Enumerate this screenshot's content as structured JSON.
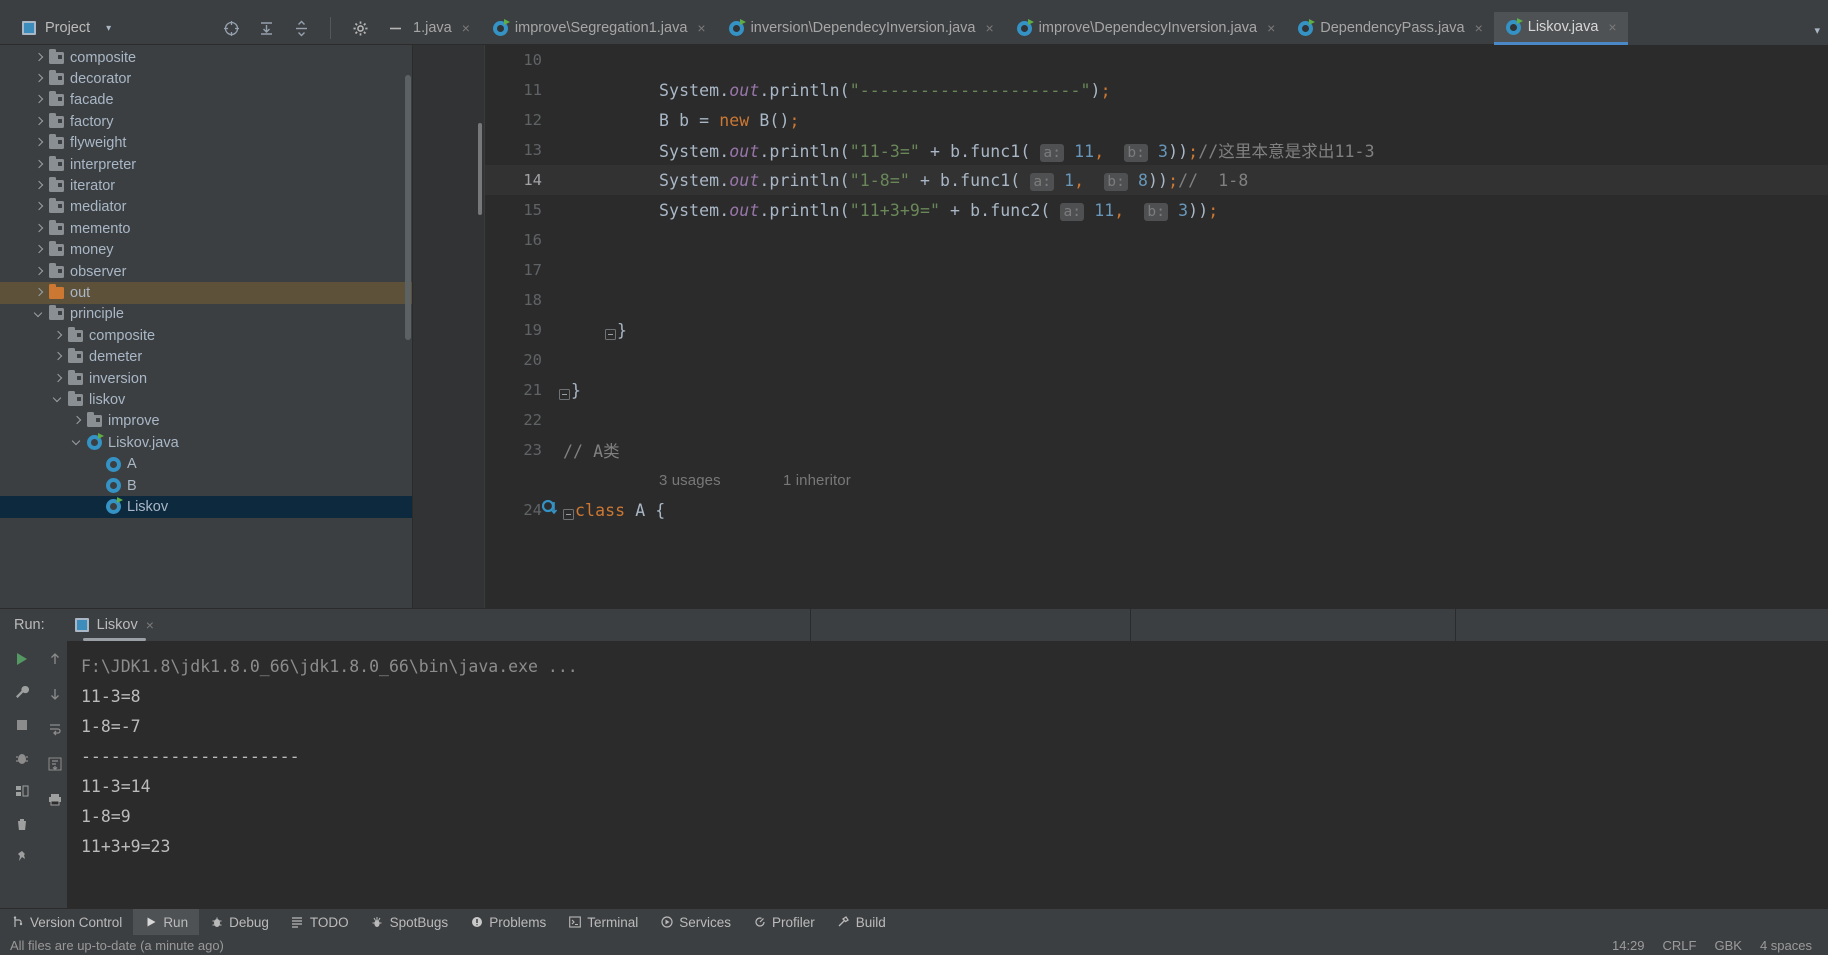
{
  "window": {
    "project_tool": {
      "title": "Project",
      "icons": [
        "target-icon",
        "expand-all-icon",
        "collapse-all-icon",
        "settings-gear-icon",
        "hide-icon"
      ]
    }
  },
  "tabs": {
    "items": [
      {
        "label": "1.java",
        "clipped": true,
        "active": false,
        "close": "×"
      },
      {
        "label": "improve\\Segregation1.java",
        "clipped": false,
        "active": false,
        "close": "×"
      },
      {
        "label": "inversion\\DependecyInversion.java",
        "clipped": false,
        "active": false,
        "close": "×"
      },
      {
        "label": "improve\\DependecyInversion.java",
        "clipped": false,
        "active": false,
        "close": "×"
      },
      {
        "label": "DependencyPass.java",
        "clipped": false,
        "active": false,
        "close": "×"
      },
      {
        "label": "Liskov.java",
        "clipped": false,
        "active": true,
        "close": "×"
      }
    ],
    "overflow_chevron": "▾"
  },
  "sidebar": {
    "items": [
      {
        "label": "composite",
        "indent": 0,
        "type": "folder",
        "state": "closed",
        "sel": ""
      },
      {
        "label": "decorator",
        "indent": 0,
        "type": "folder",
        "state": "closed",
        "sel": ""
      },
      {
        "label": "facade",
        "indent": 0,
        "type": "folder",
        "state": "closed",
        "sel": ""
      },
      {
        "label": "factory",
        "indent": 0,
        "type": "folder",
        "state": "closed",
        "sel": ""
      },
      {
        "label": "flyweight",
        "indent": 0,
        "type": "folder",
        "state": "closed",
        "sel": ""
      },
      {
        "label": "interpreter",
        "indent": 0,
        "type": "folder",
        "state": "closed",
        "sel": ""
      },
      {
        "label": "iterator",
        "indent": 0,
        "type": "folder",
        "state": "closed",
        "sel": ""
      },
      {
        "label": "mediator",
        "indent": 0,
        "type": "folder",
        "state": "closed",
        "sel": ""
      },
      {
        "label": "memento",
        "indent": 0,
        "type": "folder",
        "state": "closed",
        "sel": ""
      },
      {
        "label": "money",
        "indent": 0,
        "type": "folder",
        "state": "closed",
        "sel": ""
      },
      {
        "label": "observer",
        "indent": 0,
        "type": "folder",
        "state": "closed",
        "sel": ""
      },
      {
        "label": "out",
        "indent": 0,
        "type": "folder-orange",
        "state": "closed",
        "sel": "out"
      },
      {
        "label": "principle",
        "indent": 0,
        "type": "folder",
        "state": "open",
        "sel": ""
      },
      {
        "label": "composite",
        "indent": 1,
        "type": "folder",
        "state": "closed",
        "sel": ""
      },
      {
        "label": "demeter",
        "indent": 1,
        "type": "folder",
        "state": "closed",
        "sel": ""
      },
      {
        "label": "inversion",
        "indent": 1,
        "type": "folder",
        "state": "closed",
        "sel": ""
      },
      {
        "label": "liskov",
        "indent": 1,
        "type": "folder",
        "state": "open",
        "sel": ""
      },
      {
        "label": "improve",
        "indent": 2,
        "type": "folder",
        "state": "closed",
        "sel": ""
      },
      {
        "label": "Liskov.java",
        "indent": 2,
        "type": "java-run",
        "state": "open",
        "sel": ""
      },
      {
        "label": "A",
        "indent": 3,
        "type": "class",
        "state": "none",
        "sel": ""
      },
      {
        "label": "B",
        "indent": 3,
        "type": "class",
        "state": "none",
        "sel": ""
      },
      {
        "label": "Liskov",
        "indent": 3,
        "type": "class-run",
        "state": "none",
        "sel": "blue"
      }
    ]
  },
  "editor": {
    "lines": [
      {
        "num": "10",
        "current": false,
        "tokens": []
      },
      {
        "num": "11",
        "current": false,
        "tokens": [
          {
            "t": "System",
            "c": "punc"
          },
          {
            "t": ".",
            "c": "punc"
          },
          {
            "t": "out",
            "c": "fld"
          },
          {
            "t": ".",
            "c": "punc"
          },
          {
            "t": "println",
            "c": "mth"
          },
          {
            "t": "(",
            "c": "punc"
          },
          {
            "t": "\"----------------------\"",
            "c": "str"
          },
          {
            "t": ")",
            "c": "punc"
          },
          {
            "t": ";",
            "c": "sem"
          }
        ]
      },
      {
        "num": "12",
        "current": false,
        "tokens": [
          {
            "t": "B b ",
            "c": "punc"
          },
          {
            "t": "=",
            "c": "punc"
          },
          {
            "t": " ",
            "c": "punc"
          },
          {
            "t": "new",
            "c": "kw"
          },
          {
            "t": " B",
            "c": "punc"
          },
          {
            "t": "()",
            "c": "punc"
          },
          {
            "t": ";",
            "c": "sem"
          }
        ]
      },
      {
        "num": "13",
        "current": false,
        "tokens": [
          {
            "t": "System",
            "c": "punc"
          },
          {
            "t": ".",
            "c": "punc"
          },
          {
            "t": "out",
            "c": "fld"
          },
          {
            "t": ".",
            "c": "punc"
          },
          {
            "t": "println",
            "c": "mth"
          },
          {
            "t": "(",
            "c": "punc"
          },
          {
            "t": "\"11-3=\"",
            "c": "str"
          },
          {
            "t": " + ",
            "c": "punc"
          },
          {
            "t": "b",
            "c": "punc"
          },
          {
            "t": ".",
            "c": "punc"
          },
          {
            "t": "func1",
            "c": "mth"
          },
          {
            "t": "( ",
            "c": "punc"
          },
          {
            "t": "a:",
            "c": "hint"
          },
          {
            "t": " ",
            "c": "punc"
          },
          {
            "t": "11",
            "c": "num"
          },
          {
            "t": ",",
            "c": "sem"
          },
          {
            "t": "  ",
            "c": "punc"
          },
          {
            "t": "b:",
            "c": "hint"
          },
          {
            "t": " ",
            "c": "punc"
          },
          {
            "t": "3",
            "c": "num"
          },
          {
            "t": "))",
            "c": "punc"
          },
          {
            "t": ";",
            "c": "sem"
          },
          {
            "t": "//这里本意是求出11-3",
            "c": "cmt"
          }
        ]
      },
      {
        "num": "14",
        "current": true,
        "tokens": [
          {
            "t": "System",
            "c": "punc"
          },
          {
            "t": ".",
            "c": "punc"
          },
          {
            "t": "out",
            "c": "fld"
          },
          {
            "t": ".",
            "c": "punc"
          },
          {
            "t": "println",
            "c": "mth"
          },
          {
            "t": "(",
            "c": "punc"
          },
          {
            "t": "\"1-8=\"",
            "c": "str"
          },
          {
            "t": " + ",
            "c": "punc"
          },
          {
            "t": "b",
            "c": "punc"
          },
          {
            "t": ".",
            "c": "punc"
          },
          {
            "t": "func1",
            "c": "mth"
          },
          {
            "t": "( ",
            "c": "punc"
          },
          {
            "t": "a:",
            "c": "hint"
          },
          {
            "t": " ",
            "c": "punc"
          },
          {
            "t": "1",
            "c": "num"
          },
          {
            "t": ",",
            "c": "sem"
          },
          {
            "t": "  ",
            "c": "punc"
          },
          {
            "t": "b:",
            "c": "hint"
          },
          {
            "t": " ",
            "c": "punc"
          },
          {
            "t": "8",
            "c": "num"
          },
          {
            "t": "))",
            "c": "punc"
          },
          {
            "t": ";",
            "c": "sem"
          },
          {
            "t": "//  1-8",
            "c": "cmt"
          }
        ]
      },
      {
        "num": "15",
        "current": false,
        "tokens": [
          {
            "t": "System",
            "c": "punc"
          },
          {
            "t": ".",
            "c": "punc"
          },
          {
            "t": "out",
            "c": "fld"
          },
          {
            "t": ".",
            "c": "punc"
          },
          {
            "t": "println",
            "c": "mth"
          },
          {
            "t": "(",
            "c": "punc"
          },
          {
            "t": "\"11+3+9=\"",
            "c": "str"
          },
          {
            "t": " + ",
            "c": "punc"
          },
          {
            "t": "b",
            "c": "punc"
          },
          {
            "t": ".",
            "c": "punc"
          },
          {
            "t": "func2",
            "c": "mth"
          },
          {
            "t": "( ",
            "c": "punc"
          },
          {
            "t": "a:",
            "c": "hint"
          },
          {
            "t": " ",
            "c": "punc"
          },
          {
            "t": "11",
            "c": "num"
          },
          {
            "t": ",",
            "c": "sem"
          },
          {
            "t": "  ",
            "c": "punc"
          },
          {
            "t": "b:",
            "c": "hint"
          },
          {
            "t": " ",
            "c": "punc"
          },
          {
            "t": "3",
            "c": "num"
          },
          {
            "t": "))",
            "c": "punc"
          },
          {
            "t": ";",
            "c": "sem"
          }
        ]
      },
      {
        "num": "16",
        "current": false,
        "tokens": []
      },
      {
        "num": "17",
        "current": false,
        "tokens": []
      },
      {
        "num": "18",
        "current": false,
        "tokens": []
      },
      {
        "num": "19",
        "current": false,
        "fold": true,
        "indent": 60,
        "tokens": [
          {
            "t": "}",
            "c": "punc"
          }
        ]
      },
      {
        "num": "20",
        "current": false,
        "tokens": []
      },
      {
        "num": "21",
        "current": false,
        "fold": true,
        "indent": 14,
        "tokens": [
          {
            "t": "}",
            "c": "punc"
          }
        ]
      },
      {
        "num": "22",
        "current": false,
        "tokens": []
      },
      {
        "num": "23",
        "current": false,
        "indent": 6,
        "tokens": [
          {
            "t": "// A类",
            "c": "cmt"
          }
        ]
      }
    ],
    "inlay_usages": "3 usages",
    "inlay_inheritor": "1 inheritor",
    "last_line": {
      "num": "24",
      "tokens": [
        {
          "t": "class",
          "c": "kw"
        },
        {
          "t": " A ",
          "c": "punc"
        },
        {
          "t": "{",
          "c": "punc"
        }
      ]
    }
  },
  "run_panel": {
    "label": "Run:",
    "tab_name": "Liskov",
    "tab_close": "×",
    "left_tool_icons": [
      "rerun-play-icon",
      "wrench-settings-icon",
      "stop-icon",
      "debug-bug-icon",
      "layout-icon",
      "trash-icon",
      "pin-icon"
    ],
    "nav_tool_icons": [
      "arrow-up-icon",
      "arrow-down-icon",
      "soft-wrap-icon",
      "scroll-to-end-icon",
      "print-icon"
    ],
    "console": [
      {
        "text": "F:\\JDK1.8\\jdk1.8.0_66\\jdk1.8.0_66\\bin\\java.exe ...",
        "dim": true
      },
      {
        "text": "11-3=8",
        "dim": false
      },
      {
        "text": "1-8=-7",
        "dim": false
      },
      {
        "text": "----------------------",
        "dim": false
      },
      {
        "text": "11-3=14",
        "dim": false
      },
      {
        "text": "1-8=9",
        "dim": false
      },
      {
        "text": "11+3+9=23",
        "dim": false
      }
    ]
  },
  "bottom_bar": {
    "items": [
      {
        "label": "Version Control",
        "icon": "branch-icon",
        "active": false
      },
      {
        "label": "Run",
        "icon": "play-icon",
        "active": true
      },
      {
        "label": "Debug",
        "icon": "bug-icon",
        "active": false
      },
      {
        "label": "TODO",
        "icon": "list-icon",
        "active": false
      },
      {
        "label": "SpotBugs",
        "icon": "spotbugs-icon",
        "active": false
      },
      {
        "label": "Problems",
        "icon": "problems-icon",
        "active": false
      },
      {
        "label": "Terminal",
        "icon": "terminal-icon",
        "active": false
      },
      {
        "label": "Services",
        "icon": "services-icon",
        "active": false
      },
      {
        "label": "Profiler",
        "icon": "profiler-icon",
        "active": false
      },
      {
        "label": "Build",
        "icon": "build-hammer-icon",
        "active": false
      }
    ]
  },
  "status_bar": {
    "message": "All files are up-to-date (a minute ago)",
    "right": [
      "14:29",
      "CRLF",
      "GBK",
      "4 spaces"
    ]
  }
}
